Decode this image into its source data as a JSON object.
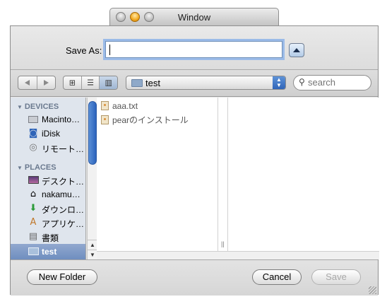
{
  "window": {
    "title": "Window"
  },
  "save_as": {
    "label": "Save As:",
    "value": ""
  },
  "toolbar": {
    "location": "test",
    "search_placeholder": "search"
  },
  "sidebar": {
    "devices_header": "DEVICES",
    "places_header": "PLACES",
    "devices": [
      {
        "label": "Macinto…",
        "icon": "hard-drive-icon"
      },
      {
        "label": "iDisk",
        "icon": "idisk-icon"
      },
      {
        "label": "リモート…",
        "icon": "remote-disc-icon"
      }
    ],
    "places": [
      {
        "label": "デスクト…",
        "icon": "desktop-icon"
      },
      {
        "label": "nakamu…",
        "icon": "home-icon"
      },
      {
        "label": "ダウンロ…",
        "icon": "downloads-icon"
      },
      {
        "label": "アプリケ…",
        "icon": "applications-icon"
      },
      {
        "label": "書類",
        "icon": "documents-icon"
      },
      {
        "label": "test",
        "icon": "folder-icon"
      }
    ]
  },
  "files": [
    {
      "name": "aaa.txt"
    },
    {
      "name": "pearのインストール"
    }
  ],
  "buttons": {
    "new_folder": "New Folder",
    "cancel": "Cancel",
    "save": "Save"
  },
  "colors": {
    "selection": "#7d97c4",
    "focus_ring": "#9bbbe8",
    "sidebar_bg": "#dfe5ed"
  }
}
